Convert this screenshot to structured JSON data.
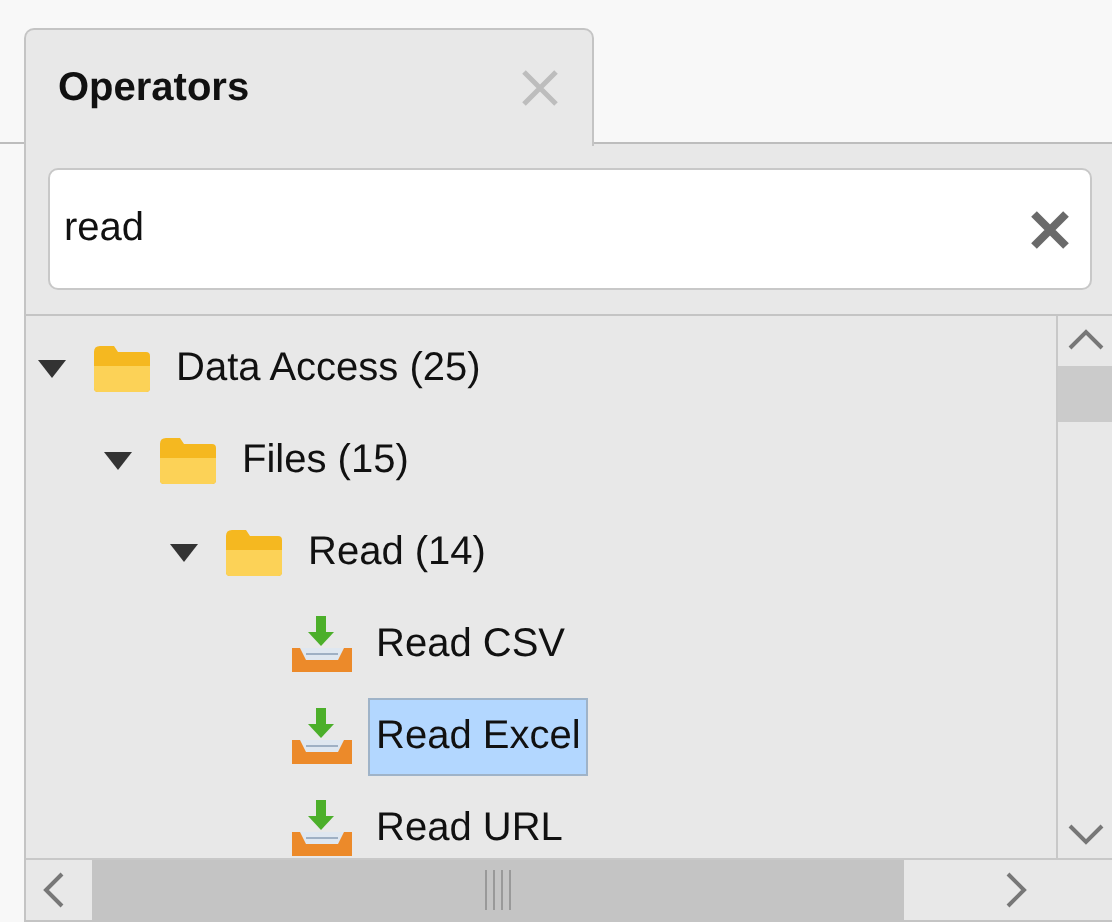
{
  "tab": {
    "label": "Operators",
    "selected": true
  },
  "search": {
    "value": "read"
  },
  "tree": [
    {
      "label": "Data Access (25)",
      "kind": "folder",
      "expanded": true,
      "selected": false,
      "children": [
        {
          "label": "Files (15)",
          "kind": "folder",
          "expanded": true,
          "selected": false,
          "children": [
            {
              "label": "Read (14)",
              "kind": "folder",
              "expanded": true,
              "selected": false,
              "children": [
                {
                  "label": "Read CSV",
                  "kind": "operator",
                  "selected": false
                },
                {
                  "label": "Read Excel",
                  "kind": "operator",
                  "selected": true
                },
                {
                  "label": "Read URL",
                  "kind": "operator",
                  "selected": false
                }
              ]
            }
          ]
        }
      ]
    }
  ]
}
